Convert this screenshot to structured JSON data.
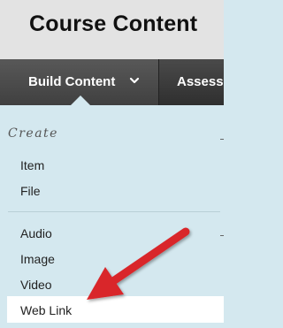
{
  "page": {
    "title": "Course Content"
  },
  "toolbar": {
    "build_content_label": "Build Content",
    "assessments_label": "Assessments"
  },
  "menu": {
    "section_header": "Create",
    "items": [
      {
        "label": "Item"
      },
      {
        "label": "File"
      },
      {
        "label": "Audio"
      },
      {
        "label": "Image"
      },
      {
        "label": "Video"
      },
      {
        "label": "Web Link"
      }
    ],
    "highlighted_item": "Web Link"
  },
  "colors": {
    "toolbar_bg": "#3a3a3a",
    "menu_bg": "#d4e8ef",
    "highlight_bg": "#ffffff",
    "arrow": "#d9262b"
  },
  "icons": {
    "build_content_dropdown": "chevron-down-icon",
    "annotation": "red-arrow-icon"
  }
}
